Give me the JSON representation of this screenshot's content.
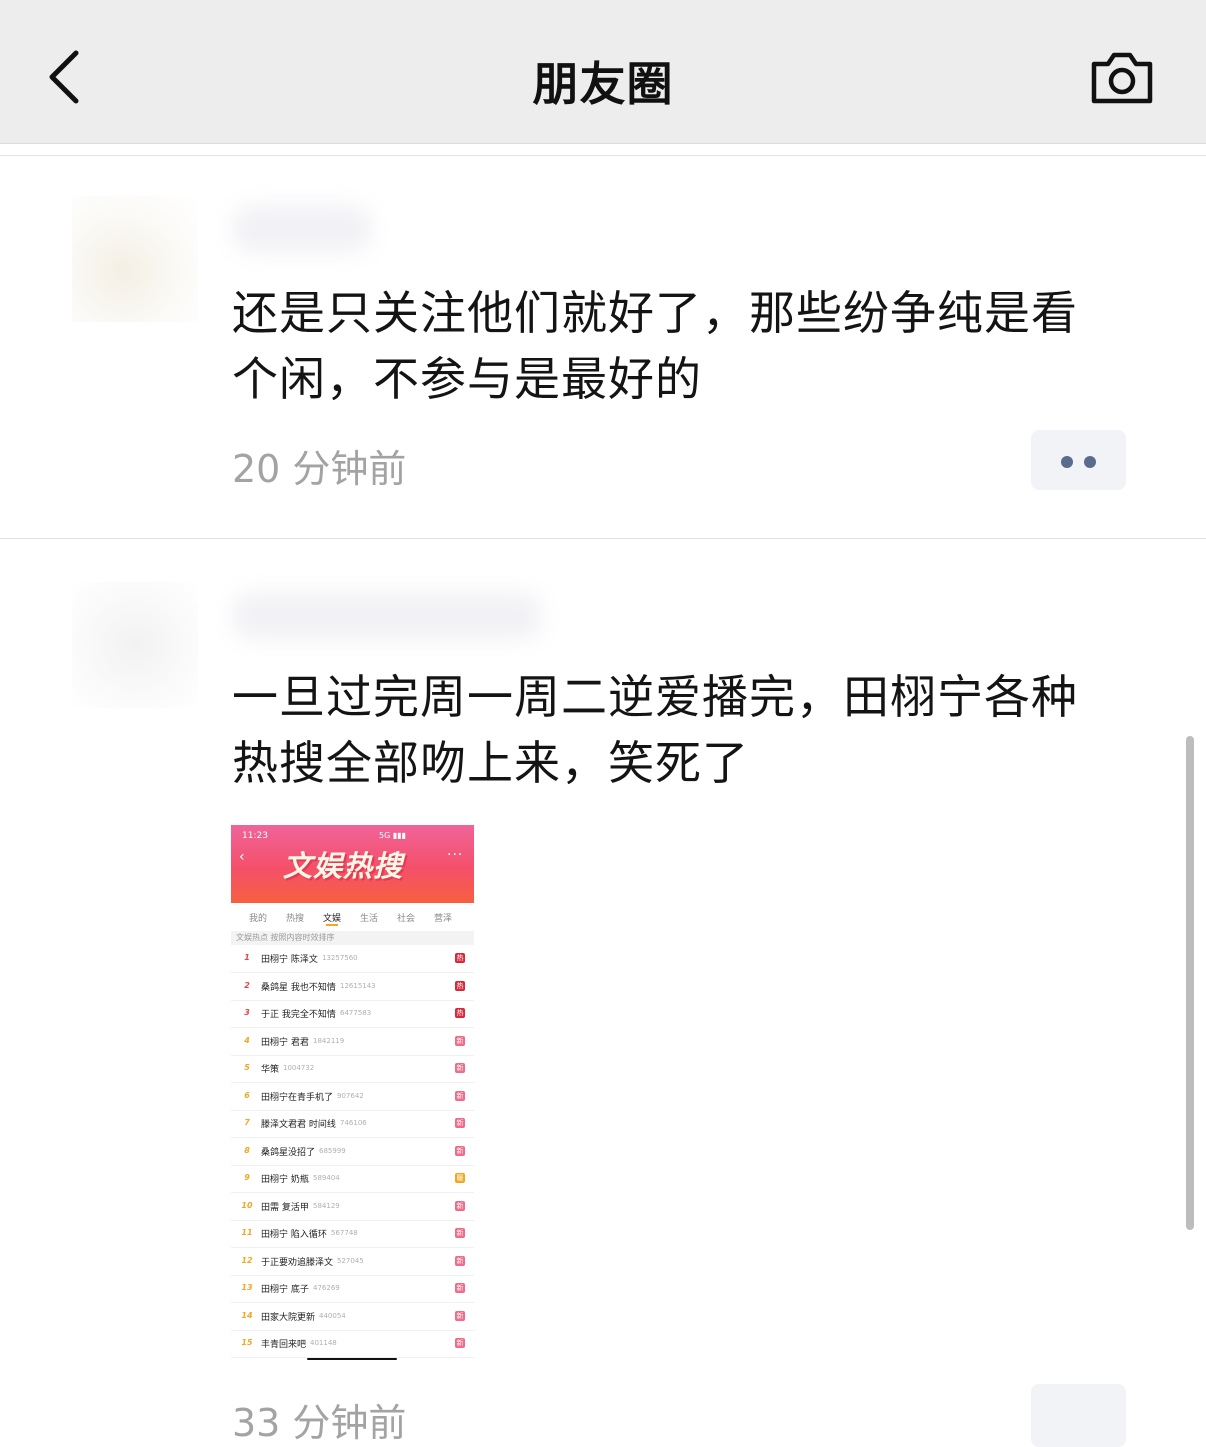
{
  "header": {
    "back_icon": "chevron-left-icon",
    "title": "朋友圈",
    "camera_icon": "camera-icon"
  },
  "posts": [
    {
      "text": "还是只关注他们就好了，那些纷争纯是看个闲，不参与是最好的",
      "time": "20 分钟前",
      "more_icon": "more-dots-icon"
    },
    {
      "text": "一旦过完周一周二逆爱播完，田栩宁各种热搜全部吻上来，笑死了",
      "time": "33 分钟前",
      "image": {
        "status_time": "11:23",
        "status_right": "5G ▮▮▮",
        "back_icon": "chevron-left-icon",
        "more_icon": "ellipsis-icon",
        "banner_title": "文娱热搜",
        "tabs": [
          {
            "label": "我的",
            "active": false
          },
          {
            "label": "热搜",
            "active": false
          },
          {
            "label": "文娱",
            "active": true
          },
          {
            "label": "生活",
            "active": false
          },
          {
            "label": "社会",
            "active": false
          },
          {
            "label": "营泽",
            "active": false
          }
        ],
        "sub_header": "文娱热点 按照内容时效排序",
        "rows": [
          {
            "rank": "1",
            "keyword": "田栩宁 陈泽文",
            "heat": "13257560",
            "badge": "热"
          },
          {
            "rank": "2",
            "keyword": "桑鸽星 我也不知情",
            "heat": "12615143",
            "badge": "热"
          },
          {
            "rank": "3",
            "keyword": "于正 我完全不知情",
            "heat": "6477583",
            "badge": "热"
          },
          {
            "rank": "4",
            "keyword": "田栩宁 君君",
            "heat": "1842119",
            "badge": "新"
          },
          {
            "rank": "5",
            "keyword": "华策",
            "heat": "1004732",
            "badge": "新"
          },
          {
            "rank": "6",
            "keyword": "田栩宁在青手机了",
            "heat": "907642",
            "badge": "新"
          },
          {
            "rank": "7",
            "keyword": "滕泽文君君 时间线",
            "heat": "746106",
            "badge": "新"
          },
          {
            "rank": "8",
            "keyword": "桑鸽星没招了",
            "heat": "685999",
            "badge": "新"
          },
          {
            "rank": "9",
            "keyword": "田栩宁 奶瓶",
            "heat": "589404",
            "badge": "暖"
          },
          {
            "rank": "10",
            "keyword": "田需 复活甲",
            "heat": "584129",
            "badge": "新"
          },
          {
            "rank": "11",
            "keyword": "田栩宁 陷入循环",
            "heat": "567748",
            "badge": "新"
          },
          {
            "rank": "12",
            "keyword": "于正要劝追滕泽文",
            "heat": "527045",
            "badge": "新"
          },
          {
            "rank": "13",
            "keyword": "田栩宁 底子",
            "heat": "476269",
            "badge": "新"
          },
          {
            "rank": "14",
            "keyword": "田家大院更新",
            "heat": "440054",
            "badge": "新"
          },
          {
            "rank": "15",
            "keyword": "丰青回来吧",
            "heat": "401148",
            "badge": "新"
          }
        ],
        "colors": {
          "hot": "#d9283a",
          "new": "#f06a8a",
          "warm": "#f5a623",
          "rank_top": "#e8404a",
          "rank_other": "#f5a623"
        }
      }
    }
  ]
}
